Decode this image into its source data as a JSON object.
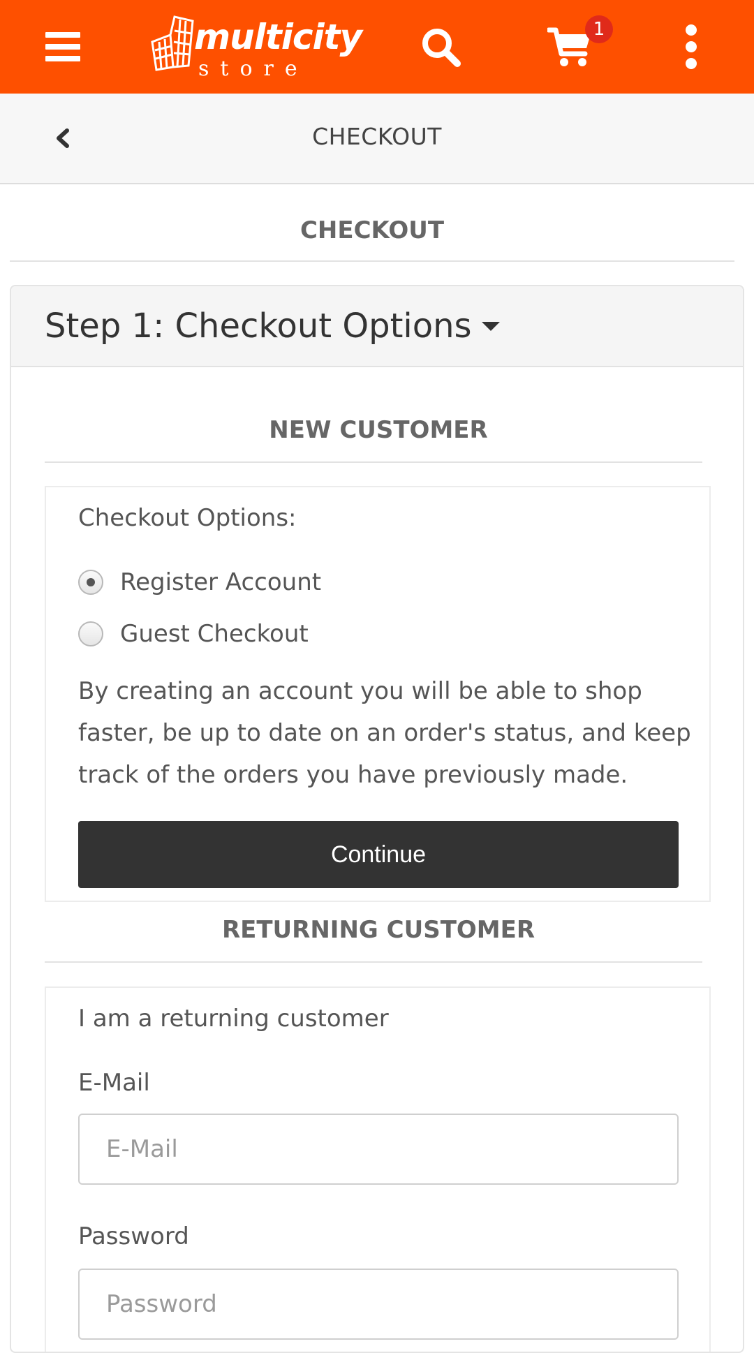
{
  "app": {
    "brand_word": "multicity",
    "brand_sub": "store",
    "cart_count": "1",
    "icons": {
      "menu": "hamburger-icon",
      "search": "search-icon",
      "cart": "cart-icon",
      "more": "more-vertical-icon",
      "back": "chevron-left-icon",
      "caret": "caret-down-icon"
    },
    "colors": {
      "brand": "#fe5000",
      "badge": "#e02a1a",
      "button": "#333333"
    }
  },
  "subheader": {
    "title": "CHECKOUT"
  },
  "page": {
    "heading": "CHECKOUT"
  },
  "step1": {
    "title": "Step 1: Checkout Options",
    "new_customer": {
      "title": "NEW CUSTOMER",
      "options_label": "Checkout Options:",
      "options": [
        {
          "label": "Register Account",
          "checked": true
        },
        {
          "label": "Guest Checkout",
          "checked": false
        }
      ],
      "description": "By creating an account you will be able to shop faster, be up to date on an order's status, and keep track of the orders you have previously made.",
      "continue_label": "Continue"
    },
    "returning_customer": {
      "title": "RETURNING CUSTOMER",
      "intro": "I am a returning customer",
      "email_label": "E-Mail",
      "email_placeholder": "E-Mail",
      "password_label": "Password",
      "password_placeholder": "Password"
    }
  }
}
